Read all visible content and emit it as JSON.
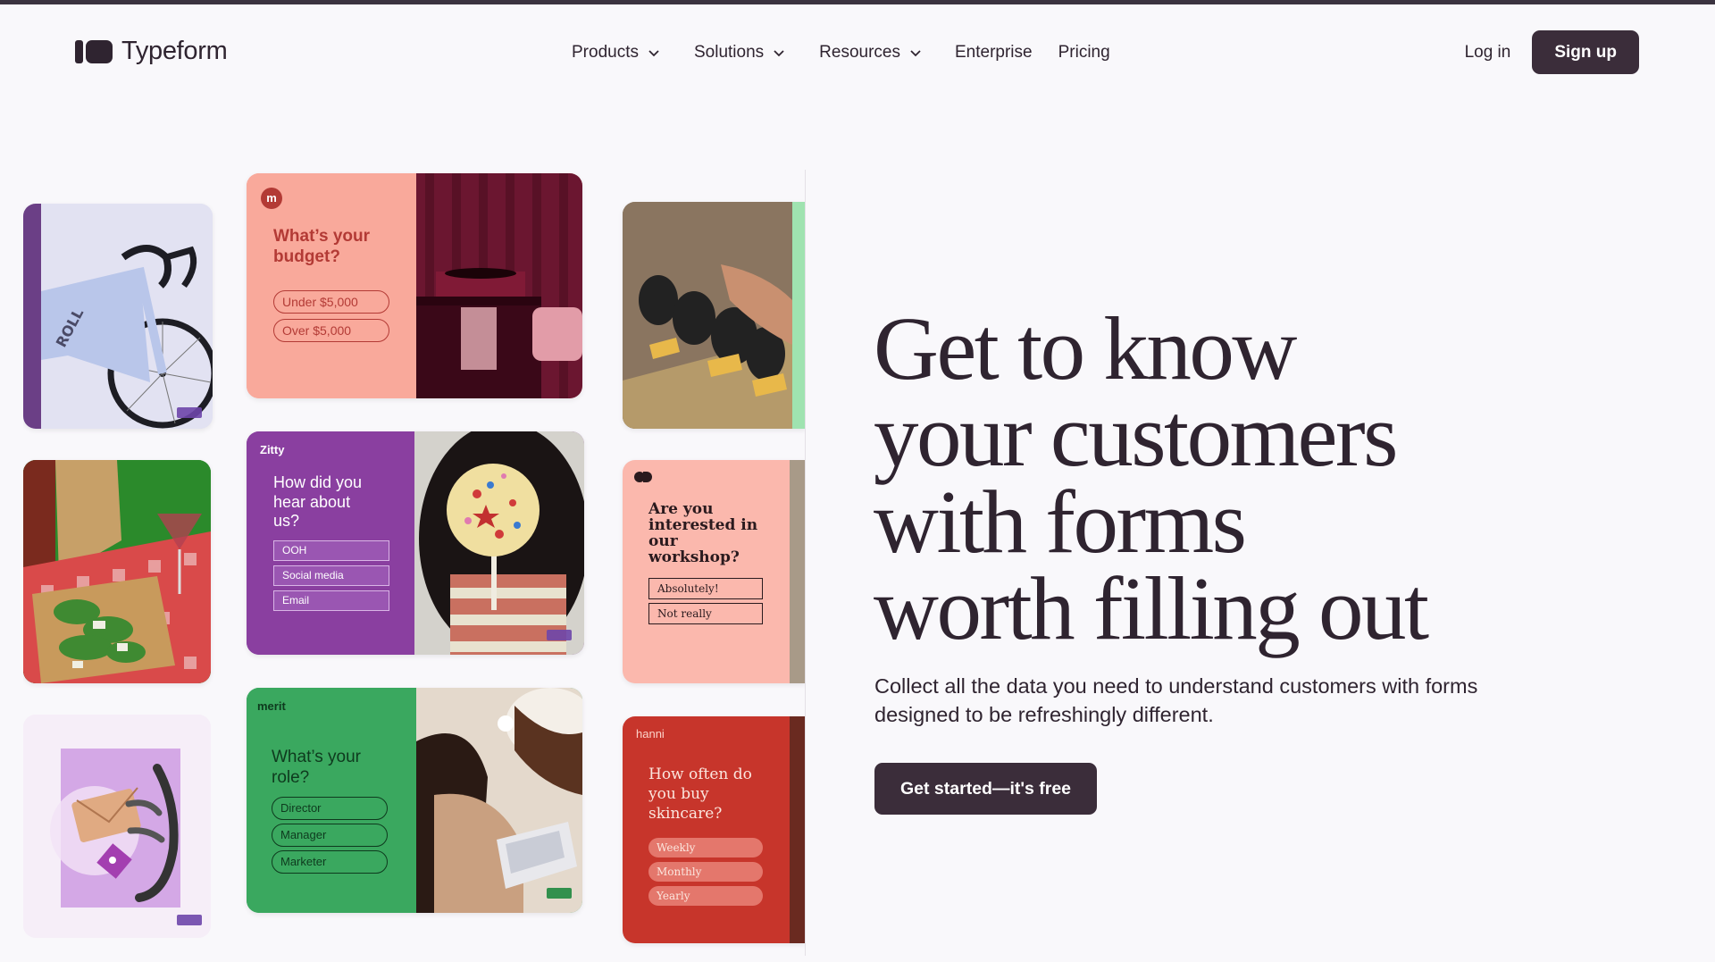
{
  "nav": {
    "logo_text": "Typeform",
    "items": [
      {
        "label": "Products",
        "has_menu": true
      },
      {
        "label": "Solutions",
        "has_menu": true
      },
      {
        "label": "Resources",
        "has_menu": true
      },
      {
        "label": "Enterprise",
        "has_menu": false
      },
      {
        "label": "Pricing",
        "has_menu": false
      }
    ],
    "login_label": "Log in",
    "signup_label": "Sign up"
  },
  "hero": {
    "headline_lines": [
      "Get to know",
      "your customers",
      "with forms",
      "worth filling out"
    ],
    "subtitle": "Collect all the data you need to understand customers with forms designed to be refreshingly different.",
    "cta_label": "Get started—it's free"
  },
  "gallery": {
    "budget_card": {
      "question": "What’s your budget?",
      "options": [
        "Under $5,000",
        "Over $5,000"
      ]
    },
    "zitty_card": {
      "brand": "Zitty",
      "question": "How did you hear about us?",
      "options": [
        "OOH",
        "Social media",
        "Email"
      ]
    },
    "workshop_card": {
      "question": "Are you interested in our workshop?",
      "options": [
        "Absolutely!",
        "Not really"
      ]
    },
    "merit_card": {
      "brand": "merit",
      "question": "What’s your role?",
      "options": [
        "Director",
        "Manager",
        "Marketer"
      ]
    },
    "hanni_card": {
      "brand": "hanni",
      "question": "How often do you buy skincare?",
      "options": [
        "Weekly",
        "Monthly",
        "Yearly"
      ]
    },
    "bike_card": {
      "frame_text": "ROLL"
    }
  },
  "colors": {
    "ink": "#2f2430",
    "button": "#3b2d3a",
    "background": "#f9f8fb",
    "pink": "#f9a99b",
    "purple": "#8a3fa0",
    "green": "#3aa85f",
    "red": "#c7352b"
  }
}
